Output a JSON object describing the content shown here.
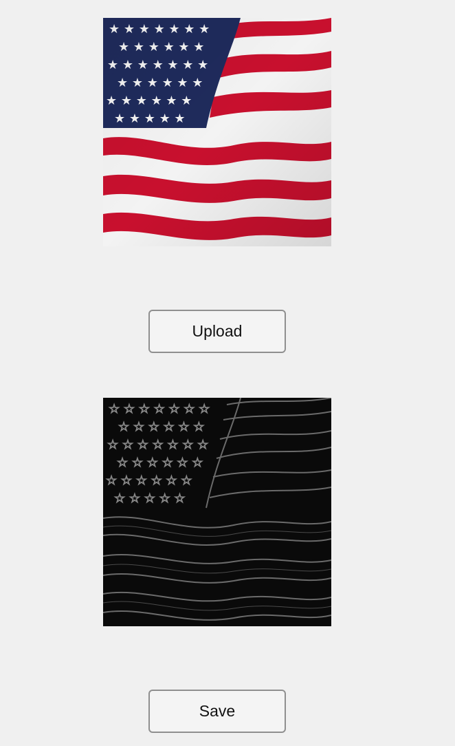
{
  "buttons": {
    "upload_label": "Upload",
    "save_label": "Save"
  },
  "images": {
    "original": {
      "subject": "waving-us-flag",
      "colors": {
        "blue": "#1f2b5c",
        "red": "#c8102e",
        "white": "#f3f3f3"
      }
    },
    "processed": {
      "subject": "edge-filtered-us-flag",
      "colors": {
        "background": "#0a0a0a",
        "edge": "#8a8a8a"
      }
    }
  }
}
